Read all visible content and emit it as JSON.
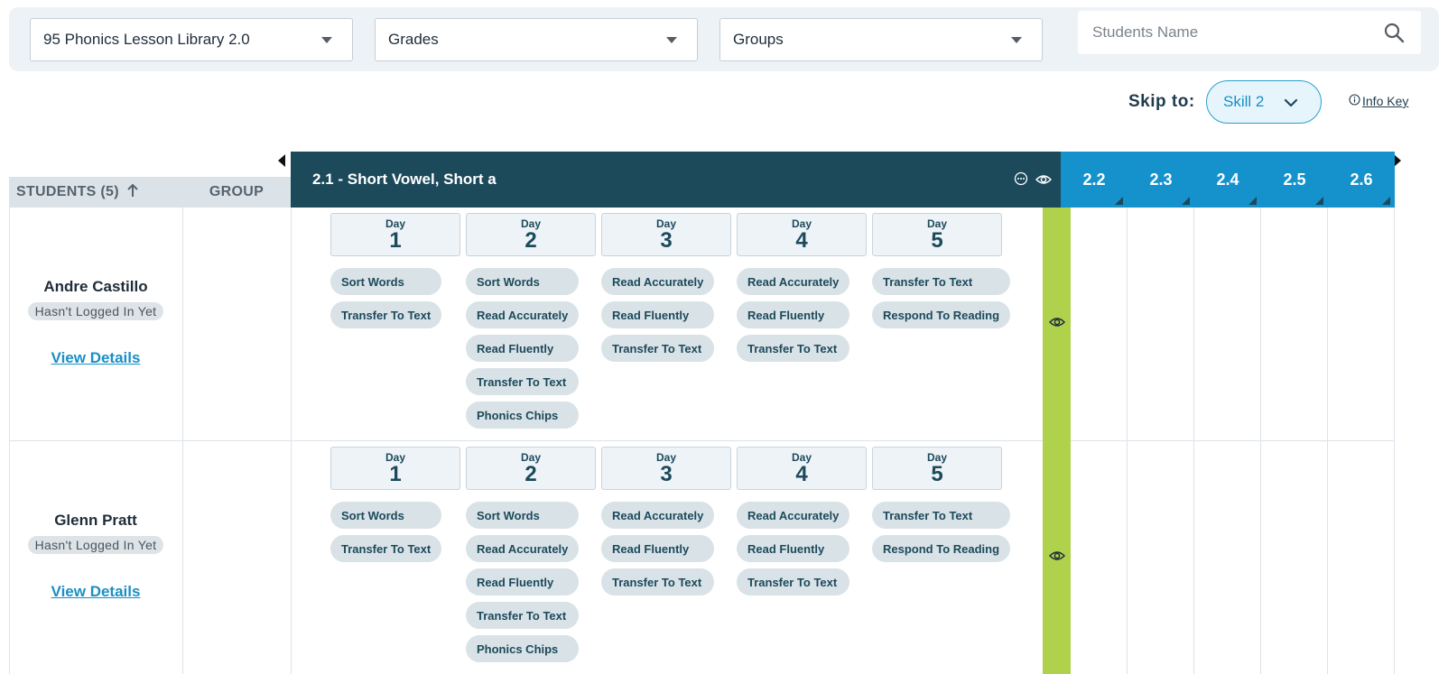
{
  "filters": {
    "library": "95 Phonics Lesson Library 2.0",
    "grades": "Grades",
    "groups": "Groups",
    "search_placeholder": "Students Name"
  },
  "skip": {
    "label": "Skip to:",
    "value": "Skill 2",
    "info_key": "Info Key"
  },
  "table": {
    "students_header": "STUDENTS (5)",
    "group_header": "GROUP",
    "current_skill": "2.1 - Short Vowel, Short a",
    "other_skills": [
      "2.2",
      "2.3",
      "2.4",
      "2.5",
      "2.6"
    ]
  },
  "day_label": "Day",
  "students": [
    {
      "name": "Andre Castillo",
      "status": "Hasn't Logged In Yet",
      "link": "View Details",
      "days": [
        {
          "num": "1",
          "activities": [
            "Sort Words",
            "Transfer To Text"
          ]
        },
        {
          "num": "2",
          "activities": [
            "Sort Words",
            "Read Accurately",
            "Read Fluently",
            "Transfer To Text",
            "Phonics Chips"
          ]
        },
        {
          "num": "3",
          "activities": [
            "Read Accurately",
            "Read Fluently",
            "Transfer To Text"
          ]
        },
        {
          "num": "4",
          "activities": [
            "Read Accurately",
            "Read Fluently",
            "Transfer To Text"
          ]
        },
        {
          "num": "5",
          "activities": [
            "Transfer To Text",
            "Respond To Reading"
          ]
        }
      ]
    },
    {
      "name": "Glenn Pratt",
      "status": "Hasn't Logged In Yet",
      "link": "View Details",
      "days": [
        {
          "num": "1",
          "activities": [
            "Sort Words",
            "Transfer To Text"
          ]
        },
        {
          "num": "2",
          "activities": [
            "Sort Words",
            "Read Accurately",
            "Read Fluently",
            "Transfer To Text",
            "Phonics Chips"
          ]
        },
        {
          "num": "3",
          "activities": [
            "Read Accurately",
            "Read Fluently",
            "Transfer To Text"
          ]
        },
        {
          "num": "4",
          "activities": [
            "Read Accurately",
            "Read Fluently",
            "Transfer To Text"
          ]
        },
        {
          "num": "5",
          "activities": [
            "Transfer To Text",
            "Respond To Reading"
          ]
        }
      ]
    }
  ],
  "colors": {
    "skill_header": "#1c4a5b",
    "other_skill_header": "#1592cb",
    "complete_column": "#afd14c",
    "link": "#1a8fc4"
  }
}
